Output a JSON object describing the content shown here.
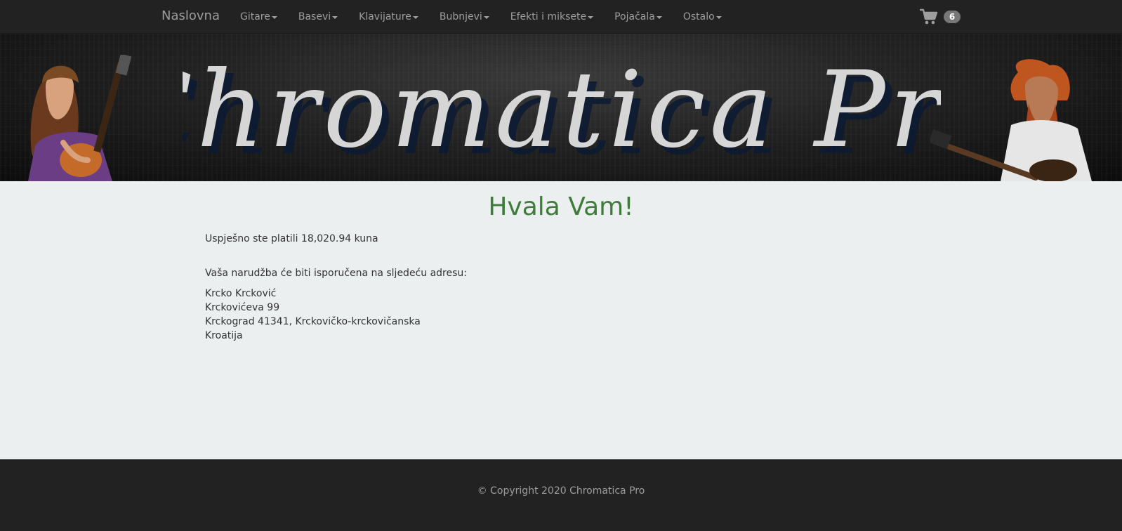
{
  "navbar": {
    "brand": "Naslovna",
    "menu": [
      {
        "label": "Gitare"
      },
      {
        "label": "Basevi"
      },
      {
        "label": "Klavijature"
      },
      {
        "label": "Bubnjevi"
      },
      {
        "label": "Efekti i miksete"
      },
      {
        "label": "Pojačala"
      },
      {
        "label": "Ostalo"
      }
    ],
    "cart": {
      "icon": "shopping-cart-icon",
      "count": "6"
    }
  },
  "banner": {
    "logo_text": "Chromatica Pro"
  },
  "main": {
    "headline": "Hvala Vam!",
    "paid_message": "Uspješno ste platili 18,020.94 kuna",
    "delivery_message": "Vaša narudžba će biti isporučena na sljedeću adresu:",
    "address": {
      "name": "Krcko Krcković",
      "street": "Krckovićeva 99",
      "city_line": "Krckograd 41341, Krckovičko-krckovičanska",
      "country": "Kroatija"
    }
  },
  "footer": {
    "copyright": "© Copyright 2020 Chromatica Pro"
  },
  "colors": {
    "navbar_bg": "#222222",
    "page_bg": "#ebeff0",
    "headline": "#3f7b3a",
    "nav_text": "#9d9d9d",
    "badge_bg": "#777777"
  }
}
